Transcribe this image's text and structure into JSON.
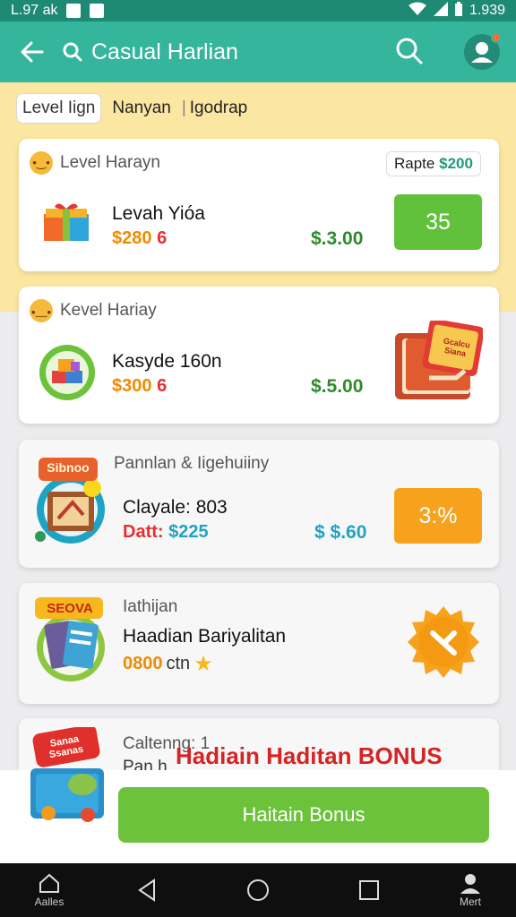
{
  "status": {
    "time_left": "L.97 ak",
    "time_right": "1.939"
  },
  "appbar": {
    "title": "Casual Harlian"
  },
  "tabs": {
    "active": "Level Iign",
    "second": "Nanyan",
    "third": "Igodrap"
  },
  "cards": [
    {
      "header": "Level Harayn",
      "title": "Levah Yióa",
      "price": "$280",
      "price_suffix": "6",
      "value": "$.3.00",
      "badge_prefix": "Rapte",
      "badge_value": "$200",
      "button": "35"
    },
    {
      "header": "Kevel Hariay",
      "title": "Kasyde 160n",
      "price": "$300",
      "price_suffix": "6",
      "value": "$.5.00",
      "illus_text": "Gcalcu Siana"
    },
    {
      "header": "Pannlan & Iigehuiiny",
      "title": "Clayale: 803",
      "price_label": "Datt:",
      "price": "$225",
      "value": "$ $.60",
      "button": "3:%",
      "illus_text": "Sibnoo"
    },
    {
      "header": "Iathijan",
      "title": "Haadian Bariyalitan",
      "price": "0800",
      "price_suffix": "ctn",
      "illus_text": "SEOVA"
    },
    {
      "header": "Caltenng: 1",
      "subheader": "Pan h",
      "illus_text": "Sanaa Ssanas"
    }
  ],
  "bonus": {
    "headline": "Hadiain Haditan BONUS",
    "button": "Haitain Bonus"
  },
  "navbar": {
    "left_label": "Aalles",
    "right_label": "Mert"
  }
}
